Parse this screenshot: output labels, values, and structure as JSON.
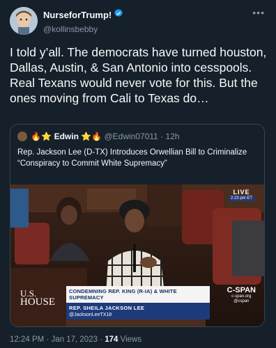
{
  "author": {
    "display_name": "NurseforTrump!",
    "handle": "@kollinsbebby"
  },
  "more_icon": "more-horizontal-icon",
  "tweet": {
    "text": "I told y’all. The democrats have turned houston, Dallas, Austin, & San Antonio into cesspools. Real Texans would never vote for this. But the ones moving from Cali to Texas do…"
  },
  "quote": {
    "emoji_left": "🔥⭐",
    "display_name": "Edwin",
    "emoji_right": "⭐🔥",
    "handle": "@Edwin07011",
    "separator": "·",
    "time": "12h",
    "text": "Rep. Jackson Lee (D-TX) Introduces Orwellian Bill to Criminalize “Conspiracy to Commit White Supremacy”",
    "media": {
      "live_label": "LIVE",
      "live_time": "2:23 pm ET",
      "house_logo_line1": "U.S.",
      "house_logo_line2": "HOUSE",
      "chyron_title": "CONDEMNING REP. KING (R-IA) & WHITE SUPREMACY",
      "chyron_name": "REP. SHEILA JACKSON LEE",
      "chyron_handle": "@JacksonLeeTX18",
      "network_logo": "C-SPAN",
      "network_site": "c-span.org",
      "network_social": "@cspan"
    }
  },
  "footer": {
    "time": "12:24 PM",
    "date": "Jan 17, 2023",
    "views_count": "174",
    "views_label": "Views"
  },
  "colors": {
    "background": "#15202b",
    "verified": "#1d9bf0",
    "secondary_text": "#8b98a5",
    "border": "#38444d"
  }
}
